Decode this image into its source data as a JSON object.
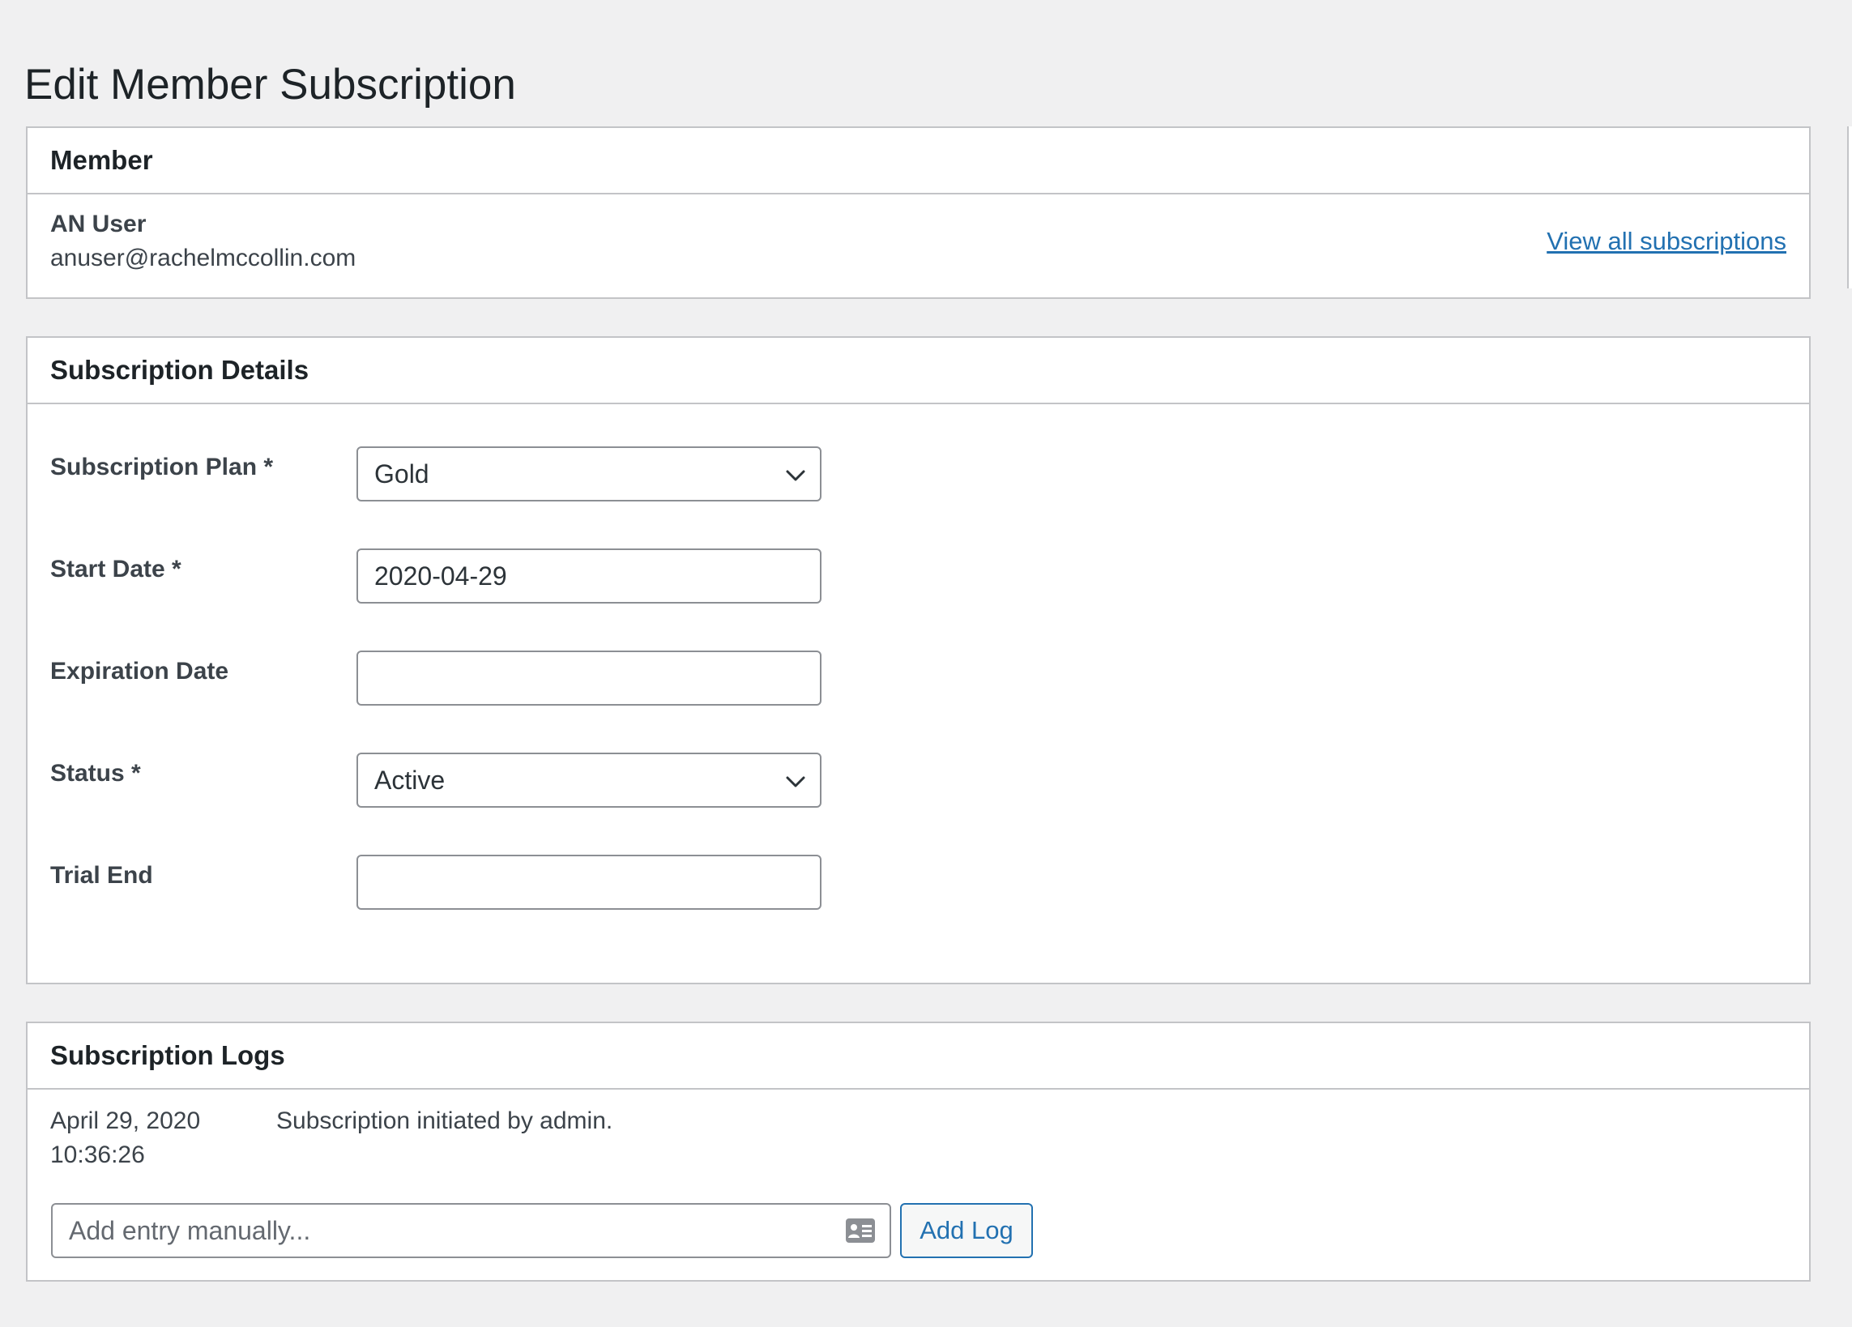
{
  "page": {
    "title": "Edit Member Subscription"
  },
  "member": {
    "heading": "Member",
    "name": "AN User",
    "email": "anuser@rachelmccollin.com",
    "view_all_label": "View all subscriptions"
  },
  "details": {
    "heading": "Subscription Details",
    "fields": [
      {
        "label": "Subscription Plan *",
        "type": "select",
        "value": "Gold"
      },
      {
        "label": "Start Date *",
        "type": "text",
        "value": "2020-04-29"
      },
      {
        "label": "Expiration Date",
        "type": "text",
        "value": ""
      },
      {
        "label": "Status *",
        "type": "select",
        "value": "Active"
      },
      {
        "label": "Trial End",
        "type": "text",
        "value": ""
      }
    ]
  },
  "logs": {
    "heading": "Subscription Logs",
    "entries": [
      {
        "date": "April 29, 2020",
        "time": "10:36:26",
        "message": "Subscription initiated by admin."
      }
    ],
    "input_placeholder": "Add entry manually...",
    "add_button_label": "Add Log"
  },
  "colors": {
    "link": "#2271b1",
    "border": "#c3c4c7",
    "background": "#f0f0f1"
  },
  "icons": {
    "select_chevron": "chevron-down-icon",
    "log_input": "contact-card-icon"
  }
}
